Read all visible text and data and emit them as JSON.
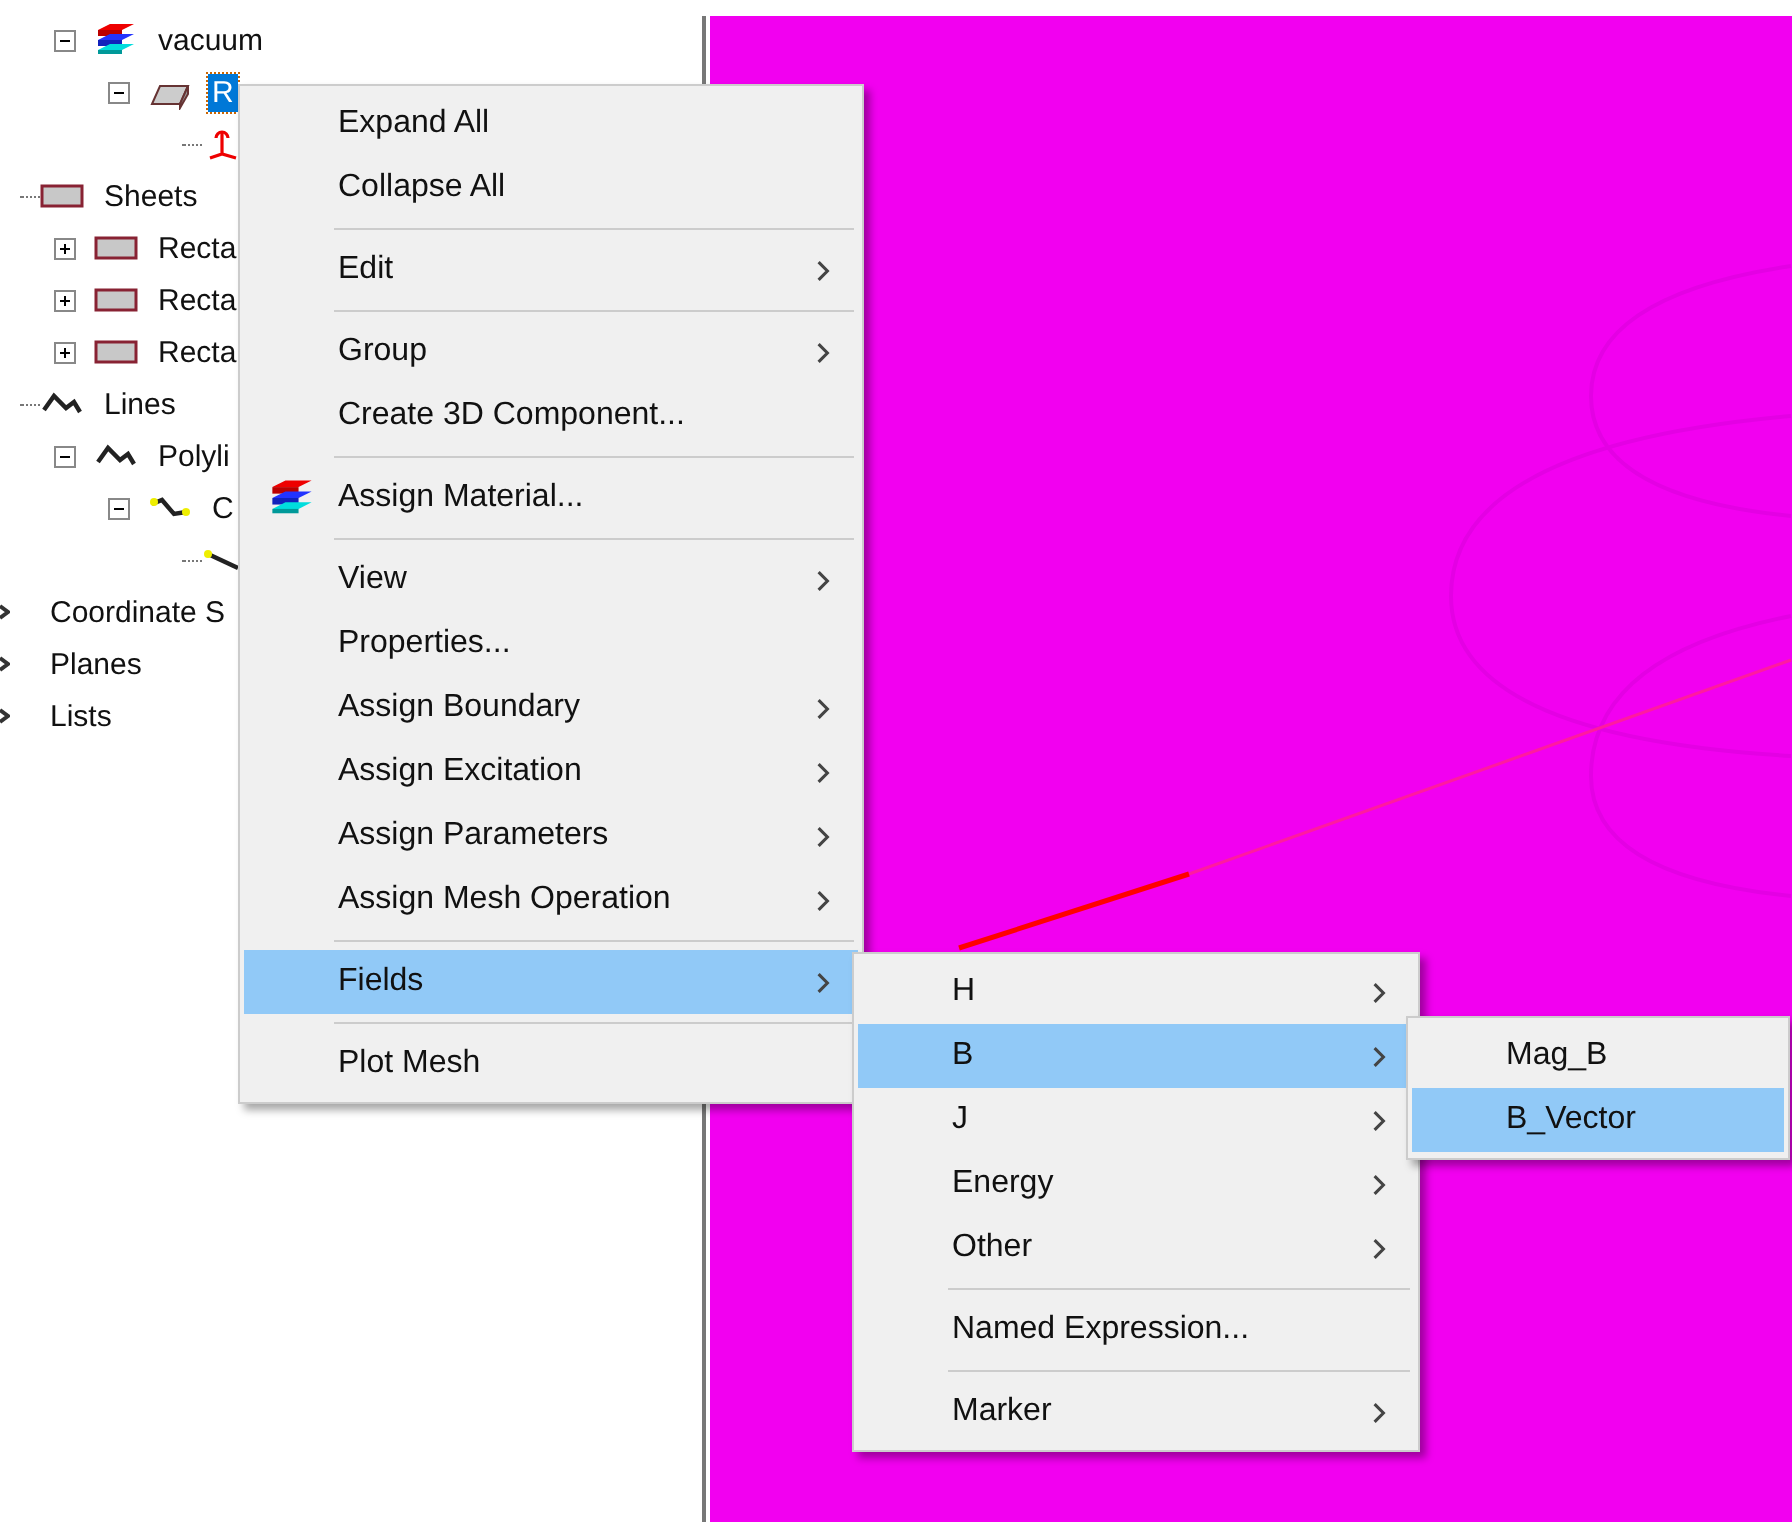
{
  "tree": [
    {
      "label": "vacuum",
      "kind": "material",
      "expanded": true,
      "selected": false,
      "children": [
        {
          "label": "R",
          "kind": "solid",
          "expanded": true,
          "selected": true,
          "children": [
            {
              "kind": "axes",
              "selected": false
            }
          ]
        }
      ]
    },
    {
      "label": "Sheets",
      "kind": "sheet",
      "selected": false,
      "children": [
        {
          "label": "Recta",
          "kind": "sheet",
          "expanded": false,
          "selected": false
        },
        {
          "label": "Recta",
          "kind": "sheet",
          "expanded": false,
          "selected": false
        },
        {
          "label": "Recta",
          "kind": "sheet",
          "expanded": false,
          "selected": false
        }
      ]
    },
    {
      "label": "Lines",
      "kind": "line",
      "selected": false,
      "children": [
        {
          "label": "Polyli",
          "kind": "line",
          "expanded": true,
          "selected": false,
          "children": [
            {
              "label": "C",
              "kind": "polyline",
              "expanded": true,
              "selected": false,
              "children": [
                {
                  "kind": "segment",
                  "selected": false
                }
              ]
            }
          ]
        }
      ]
    },
    {
      "label": "Coordinate S",
      "kind": "partial",
      "selected": false
    },
    {
      "label": "Planes",
      "kind": "partial",
      "selected": false
    },
    {
      "label": "Lists",
      "kind": "partial",
      "selected": false
    }
  ],
  "context_menu": {
    "items": [
      {
        "kind": "item",
        "label": "Expand All",
        "submenu": false,
        "selected": false
      },
      {
        "kind": "item",
        "label": "Collapse All",
        "submenu": false,
        "selected": false
      },
      {
        "kind": "separator"
      },
      {
        "kind": "item",
        "label": "Edit",
        "submenu": true,
        "selected": false
      },
      {
        "kind": "separator"
      },
      {
        "kind": "item",
        "label": "Group",
        "submenu": true,
        "selected": false
      },
      {
        "kind": "item",
        "label": "Create 3D Component...",
        "submenu": false,
        "selected": false
      },
      {
        "kind": "separator"
      },
      {
        "kind": "material_item",
        "label": "Assign Material...",
        "submenu": false,
        "selected": false
      },
      {
        "kind": "separator"
      },
      {
        "kind": "item",
        "label": "View",
        "submenu": true,
        "selected": false
      },
      {
        "kind": "item",
        "label": "Properties...",
        "submenu": false,
        "selected": false
      },
      {
        "kind": "item",
        "label": "Assign Boundary",
        "submenu": true,
        "selected": false
      },
      {
        "kind": "item",
        "label": "Assign Excitation",
        "submenu": true,
        "selected": false
      },
      {
        "kind": "item",
        "label": "Assign Parameters",
        "submenu": true,
        "selected": false
      },
      {
        "kind": "item",
        "label": "Assign Mesh Operation",
        "submenu": true,
        "selected": false
      },
      {
        "kind": "separator"
      },
      {
        "kind": "item",
        "label": "Fields",
        "submenu": true,
        "selected": true
      },
      {
        "kind": "separator"
      },
      {
        "kind": "item",
        "label": "Plot Mesh",
        "submenu": false,
        "selected": false
      }
    ]
  },
  "fields_submenu": {
    "items": [
      {
        "kind": "item",
        "label": "H",
        "submenu": true,
        "selected": false
      },
      {
        "kind": "item",
        "label": "B",
        "submenu": true,
        "selected": true
      },
      {
        "kind": "item",
        "label": "J",
        "submenu": true,
        "selected": false
      },
      {
        "kind": "item",
        "label": "Energy",
        "submenu": true,
        "selected": false
      },
      {
        "kind": "item",
        "label": "Other",
        "submenu": true,
        "selected": false
      },
      {
        "kind": "separator"
      },
      {
        "kind": "item",
        "label": "Named Expression...",
        "submenu": false,
        "selected": false
      },
      {
        "kind": "separator"
      },
      {
        "kind": "item",
        "label": "Marker",
        "submenu": true,
        "selected": false
      }
    ]
  },
  "b_submenu": {
    "items": [
      {
        "kind": "item",
        "label": "Mag_B",
        "submenu": false,
        "selected": false
      },
      {
        "kind": "item",
        "label": "B_Vector",
        "submenu": false,
        "selected": true
      }
    ]
  }
}
